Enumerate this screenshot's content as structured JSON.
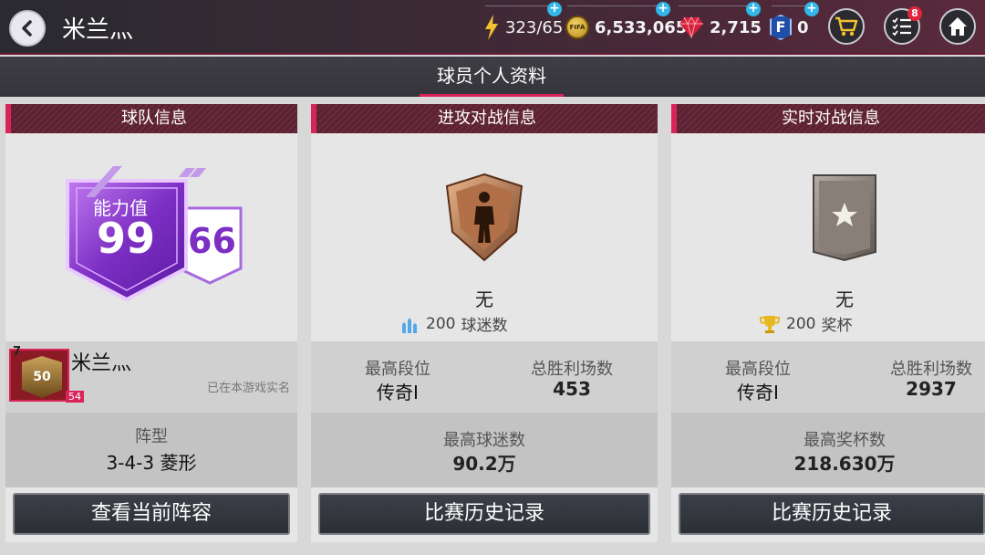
{
  "header": {
    "title": "米兰灬",
    "energy": "323/65",
    "coins": "6,533,065",
    "gems": "2,715",
    "fifa_points": "0",
    "tasks_badge": "8"
  },
  "tab": {
    "label": "球员个人资料"
  },
  "team_panel": {
    "header": "球队信息",
    "ovr_label": "能力值",
    "ovr_value": "99",
    "rank_value": "66",
    "player_name": "米兰灬",
    "level": "7",
    "card_rating": "50",
    "card_level": "54",
    "verified_text": "已在本游戏实名",
    "formation_label": "阵型",
    "formation_value": "3-4-3 菱形",
    "button": "查看当前阵容"
  },
  "attack_panel": {
    "header": "进攻对战信息",
    "rank_none": "无",
    "fans_value": "200",
    "fans_label": "球迷数",
    "best_rank_label": "最高段位",
    "best_rank_value": "传奇I",
    "total_wins_label": "总胜利场数",
    "total_wins_value": "453",
    "max_fans_label": "最高球迷数",
    "max_fans_value": "90.2万",
    "button": "比赛历史记录"
  },
  "live_panel": {
    "header": "实时对战信息",
    "rank_none": "无",
    "trophies_value": "200",
    "trophies_label": "奖杯",
    "best_rank_label": "最高段位",
    "best_rank_value": "传奇I",
    "total_wins_label": "总胜利场数",
    "total_wins_value": "2937",
    "max_trophies_label": "最高奖杯数",
    "max_trophies_value": "218.630万",
    "button": "比赛历史记录"
  },
  "colors": {
    "accent": "#d9245a",
    "ovr_purple": "#8a3fd0",
    "plus_blue": "#33b6e8"
  }
}
